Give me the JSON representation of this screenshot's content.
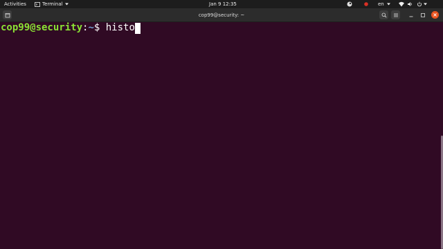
{
  "topbar": {
    "activities": "Activities",
    "app_name": "Terminal",
    "clock": "Jan 9  12:35",
    "lang": "en"
  },
  "window": {
    "title": "cop99@security: ~"
  },
  "terminal": {
    "user_host": "cop99@security",
    "colon": ":",
    "path": "~",
    "dollar": "$ ",
    "command": "histo"
  },
  "colors": {
    "terminal_bg": "#300a24",
    "prompt_user": "#8ae234",
    "prompt_path": "#729fcf",
    "close_button": "#e95420"
  },
  "icons": {
    "tray": [
      "steam-icon",
      "record-indicator-icon",
      "wifi-icon",
      "volume-icon",
      "power-icon"
    ],
    "header": [
      "new-tab-icon",
      "search-icon",
      "hamburger-menu-icon",
      "minimize-icon",
      "maximize-icon",
      "close-icon"
    ]
  }
}
